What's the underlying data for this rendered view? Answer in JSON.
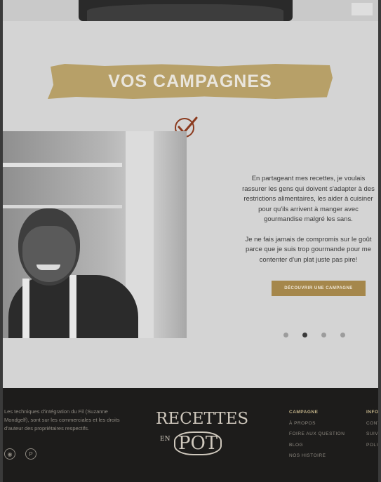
{
  "section": {
    "title": "VOS CAMPAGNES"
  },
  "campaign": {
    "paragraph1": "En partageant mes recettes, je voulais rassurer les gens qui doivent s'adapter à des restrictions alimentaires, les aider à cuisiner pour qu'ils arrivent à manger avec gourmandise malgré les sans.",
    "paragraph2": "Je ne fais jamais de compromis sur le goût parce que je suis trop gourmande pour me contenter d'un plat juste pas pire!",
    "cta_label": "DÉCOUVRIR UNE CAMPAGNE"
  },
  "carousel": {
    "dots": [
      "",
      "",
      "",
      ""
    ],
    "active_index": 1
  },
  "footer": {
    "text": "Les techniques d'intégration du Fil (Suzanne Mondgelf), sont sur les commerciales et les droits d'auteur des propriétaires respectifs.",
    "logo": {
      "line1": "RECETTES",
      "line2": "EN",
      "line3": "POT"
    },
    "col1": {
      "heading": "CAMPAGNE",
      "links": [
        "À PROPOS",
        "FOIRE AUX QUESTION",
        "BLOG",
        "NOS HISTOIRE"
      ]
    },
    "col2": {
      "heading": "INFO",
      "links": [
        "CONT",
        "SUIVE",
        "POLI"
      ]
    }
  },
  "colors": {
    "banner": "#b7a068",
    "cta": "#a5874b",
    "footer_bg": "#1d1c1b",
    "check_icon": "#8b3a1e"
  }
}
